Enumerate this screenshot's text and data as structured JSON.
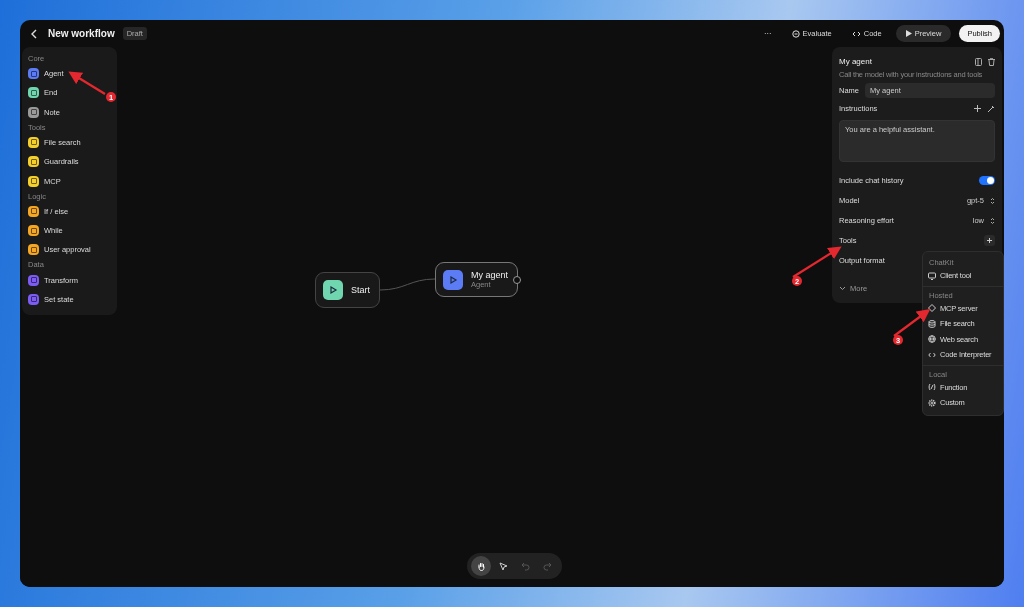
{
  "window": {
    "title": "New workflow",
    "badge": "Draft"
  },
  "toolbar": {
    "more": "···",
    "evaluate": "Evaluate",
    "code": "Code",
    "preview": "Preview",
    "publish": "Publish"
  },
  "sidebar": {
    "sections": [
      {
        "title": "Core",
        "items": [
          {
            "label": "Agent",
            "color": "#5b7cf5"
          },
          {
            "label": "End",
            "color": "#6fd6b0"
          },
          {
            "label": "Note",
            "color": "#9a9a9a"
          }
        ]
      },
      {
        "title": "Tools",
        "items": [
          {
            "label": "File search",
            "color": "#f5d02a"
          },
          {
            "label": "Guardrails",
            "color": "#f5d02a"
          },
          {
            "label": "MCP",
            "color": "#f5d02a"
          }
        ]
      },
      {
        "title": "Logic",
        "items": [
          {
            "label": "If / else",
            "color": "#f5a623"
          },
          {
            "label": "While",
            "color": "#f5a623"
          },
          {
            "label": "User approval",
            "color": "#f5a623"
          }
        ]
      },
      {
        "title": "Data",
        "items": [
          {
            "label": "Transform",
            "color": "#7c5cf5"
          },
          {
            "label": "Set state",
            "color": "#7c5cf5"
          }
        ]
      }
    ]
  },
  "nodes": [
    {
      "kind": "start",
      "title": "Start",
      "color": "#6fd6b0"
    },
    {
      "kind": "agent",
      "title": "My agent",
      "subtitle": "Agent",
      "color": "#5b7cf5"
    }
  ],
  "panel": {
    "title": "My agent",
    "description": "Call the model with your instructions and tools",
    "name_label": "Name",
    "name_value": "My agent",
    "instructions_label": "Instructions",
    "instructions_value": "You are a helpful assistant.",
    "history_label": "Include chat history",
    "history_on": true,
    "model_label": "Model",
    "model_value": "gpt-5",
    "effort_label": "Reasoning effort",
    "effort_value": "low",
    "tools_label": "Tools",
    "output_label": "Output format",
    "more_label": "More"
  },
  "menu": {
    "sections": [
      {
        "title": "ChatKit",
        "items": [
          {
            "label": "Client tool",
            "kind": "chat"
          }
        ]
      },
      {
        "title": "Hosted",
        "items": [
          {
            "label": "MCP server",
            "kind": "mcp"
          },
          {
            "label": "File search",
            "kind": "database"
          },
          {
            "label": "Web search",
            "kind": "globe"
          },
          {
            "label": "Code Interpreter",
            "kind": "code"
          }
        ]
      },
      {
        "title": "Local",
        "items": [
          {
            "label": "Function",
            "kind": "function"
          },
          {
            "label": "Custom",
            "kind": "gear"
          }
        ]
      }
    ]
  },
  "canvas_tools": [
    {
      "kind": "hand",
      "selected": true,
      "disabled": false
    },
    {
      "kind": "pointer",
      "selected": false,
      "disabled": false
    },
    {
      "kind": "undo",
      "selected": false,
      "disabled": true
    },
    {
      "kind": "redo",
      "selected": false,
      "disabled": true
    }
  ],
  "annotations": [
    {
      "number": "1"
    },
    {
      "number": "2"
    },
    {
      "number": "3"
    }
  ]
}
